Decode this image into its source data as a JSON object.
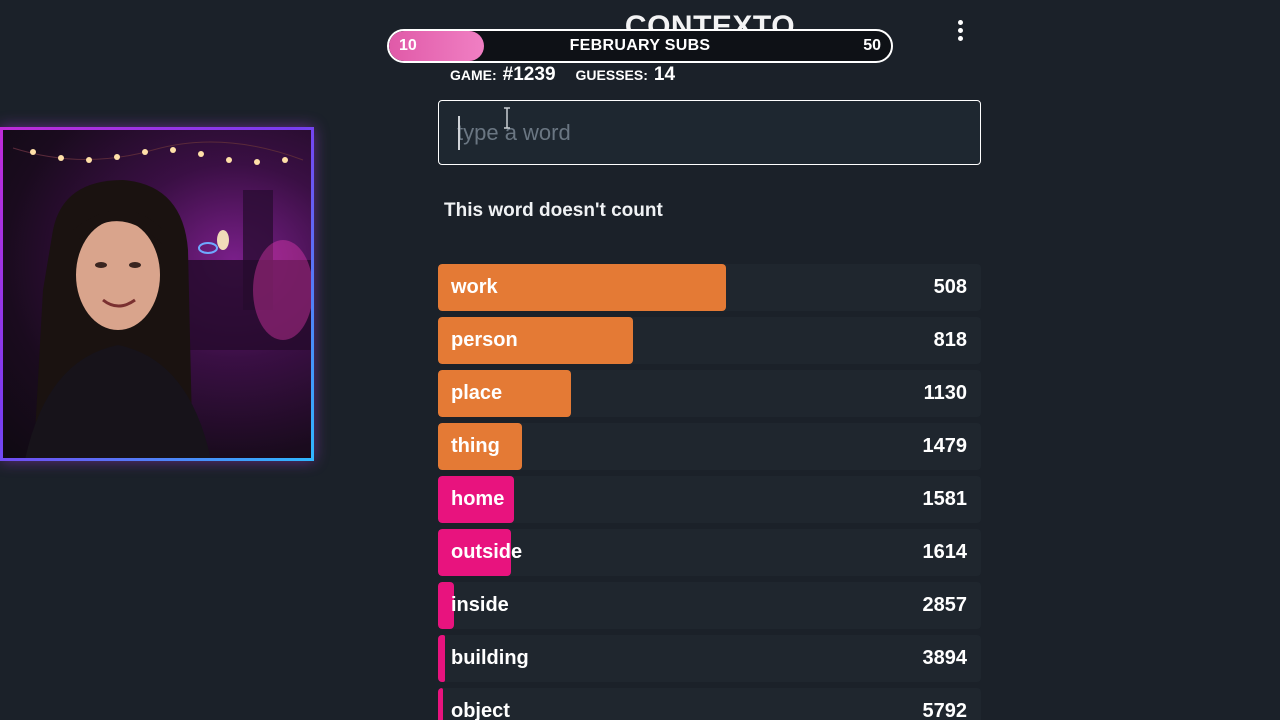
{
  "app": {
    "title": "CONTEXTO"
  },
  "sub_goal": {
    "start": "10",
    "label": "FEBRUARY SUBS",
    "end": "50",
    "progress": 0.19
  },
  "game_info": {
    "game_label": "GAME:",
    "game_value": "#1239",
    "guesses_label": "GUESSES:",
    "guesses_value": "14"
  },
  "search": {
    "placeholder": "type a word",
    "value": ""
  },
  "message": "This word doesn't count",
  "colors": {
    "orange": "#e47a35",
    "pink": "#e8137e",
    "row_bg": "#1f262e",
    "page_bg": "#1b2129"
  },
  "guesses": [
    {
      "word": "work",
      "rank": "508",
      "fill": 0.53,
      "color": "orange"
    },
    {
      "word": "person",
      "rank": "818",
      "fill": 0.36,
      "color": "orange"
    },
    {
      "word": "place",
      "rank": "1130",
      "fill": 0.245,
      "color": "orange"
    },
    {
      "word": "thing",
      "rank": "1479",
      "fill": 0.155,
      "color": "orange"
    },
    {
      "word": "home",
      "rank": "1581",
      "fill": 0.14,
      "color": "pink"
    },
    {
      "word": "outside",
      "rank": "1614",
      "fill": 0.135,
      "color": "pink"
    },
    {
      "word": "inside",
      "rank": "2857",
      "fill": 0.03,
      "color": "pink"
    },
    {
      "word": "building",
      "rank": "3894",
      "fill": 0.012,
      "color": "pink"
    },
    {
      "word": "object",
      "rank": "5792",
      "fill": 0.01,
      "color": "pink"
    }
  ]
}
